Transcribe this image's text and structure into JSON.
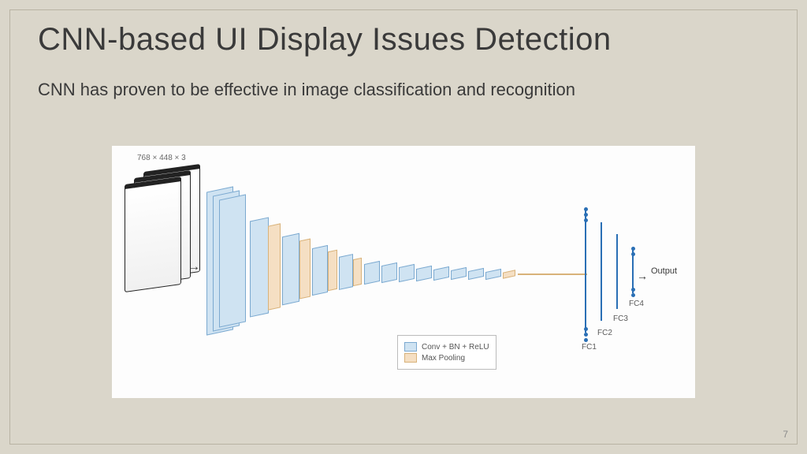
{
  "slide": {
    "title": "CNN-based UI Display Issues Detection",
    "subtitle": "CNN has proven to be effective in image classification and recognition",
    "page_number": "7"
  },
  "diagram": {
    "input_dims": "768 × 448 × 3",
    "legend": {
      "conv": "Conv + BN + ReLU",
      "pool": "Max Pooling"
    },
    "fc_labels": {
      "fc1": "FC1",
      "fc2": "FC2",
      "fc3": "FC3",
      "fc4": "FC4"
    },
    "output": "Output"
  }
}
